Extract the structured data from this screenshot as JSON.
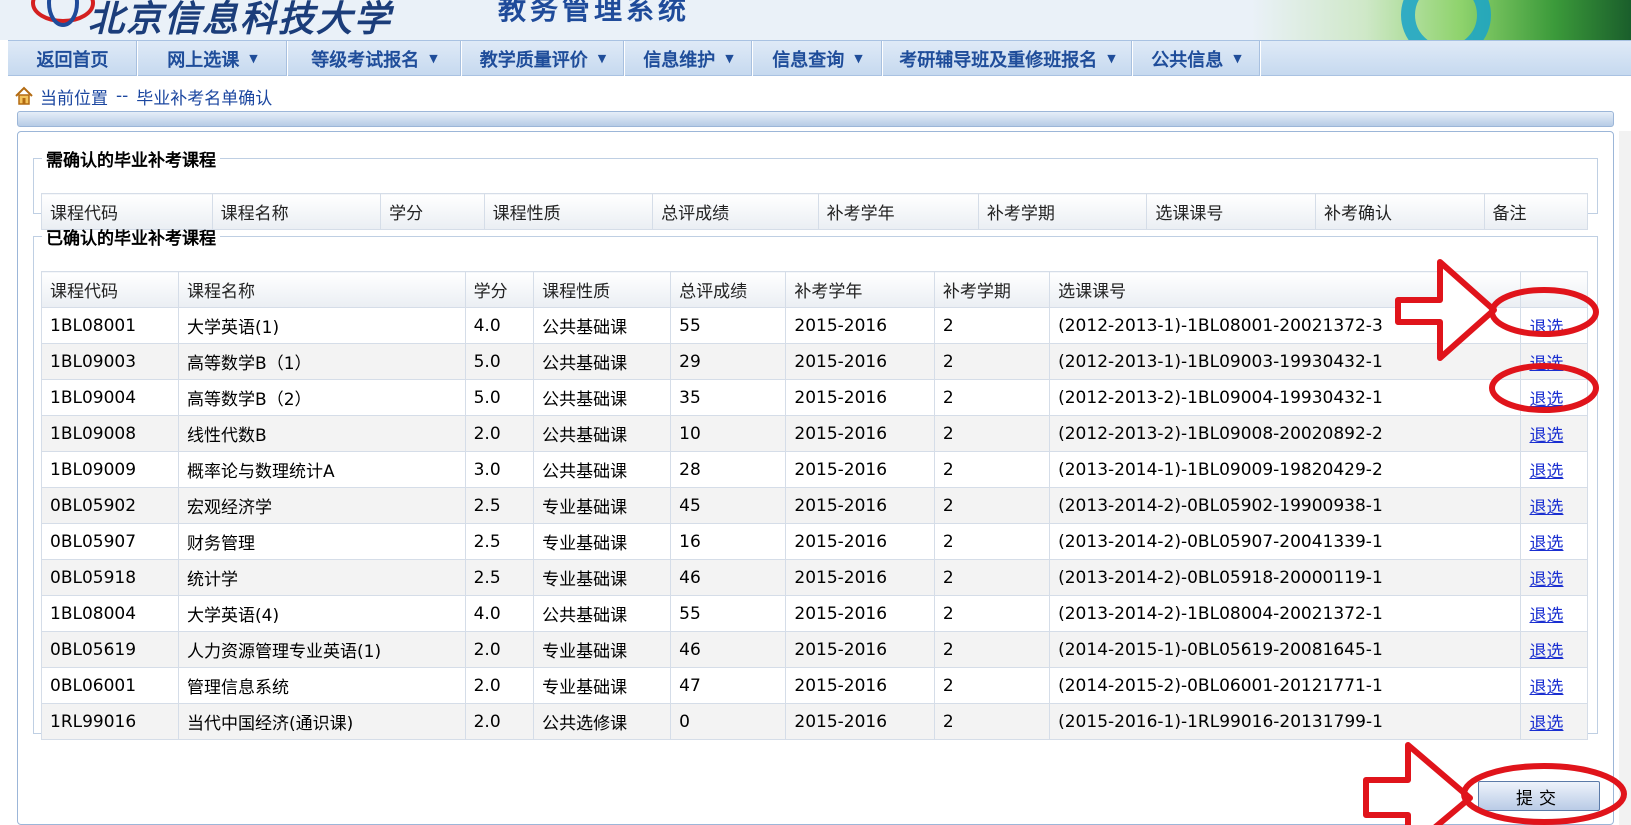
{
  "header": {
    "school_name": "北京信息科技大学",
    "system_name": "教务管理系统"
  },
  "nav": {
    "items": [
      {
        "label": "返回首页",
        "has_caret": false,
        "width": 130
      },
      {
        "label": "网上选课",
        "has_caret": true,
        "width": 150
      },
      {
        "label": "等级考试报名",
        "has_caret": true,
        "width": 174
      },
      {
        "label": "教学质量评价",
        "has_caret": true,
        "width": 163
      },
      {
        "label": "信息维护",
        "has_caret": true,
        "width": 128
      },
      {
        "label": "信息查询",
        "has_caret": true,
        "width": 130
      },
      {
        "label": "考研辅导班及重修班报名",
        "has_caret": true,
        "width": 250
      },
      {
        "label": "公共信息",
        "has_caret": true,
        "width": 128
      }
    ],
    "caret_glyph": "▼"
  },
  "breadcrumb": {
    "current_label": "当前位置",
    "separator": "--",
    "page": "毕业补考名单确认"
  },
  "pending": {
    "legend": "需确认的毕业补考课程",
    "columns": [
      "课程代码",
      "课程名称",
      "学分",
      "课程性质",
      "总评成绩",
      "补考学年",
      "补考学期",
      "选课课号",
      "补考确认",
      "备注"
    ]
  },
  "confirmed": {
    "legend": "已确认的毕业补考课程",
    "columns": [
      "课程代码",
      "课程名称",
      "学分",
      "课程性质",
      "总评成绩",
      "补考学年",
      "补考学期",
      "选课课号",
      ""
    ],
    "action_label": "退选",
    "rows": [
      [
        "1BL08001",
        "大学英语(1)",
        "4.0",
        "公共基础课",
        "55",
        "2015-2016",
        "2",
        "(2012-2013-1)-1BL08001-20021372-3"
      ],
      [
        "1BL09003",
        "高等数学B（1）",
        "5.0",
        "公共基础课",
        "29",
        "2015-2016",
        "2",
        "(2012-2013-1)-1BL09003-19930432-1"
      ],
      [
        "1BL09004",
        "高等数学B（2）",
        "5.0",
        "公共基础课",
        "35",
        "2015-2016",
        "2",
        "(2012-2013-2)-1BL09004-19930432-1"
      ],
      [
        "1BL09008",
        "线性代数B",
        "2.0",
        "公共基础课",
        "10",
        "2015-2016",
        "2",
        "(2012-2013-2)-1BL09008-20020892-2"
      ],
      [
        "1BL09009",
        "概率论与数理统计A",
        "3.0",
        "公共基础课",
        "28",
        "2015-2016",
        "2",
        "(2013-2014-1)-1BL09009-19820429-2"
      ],
      [
        "0BL05902",
        "宏观经济学",
        "2.5",
        "专业基础课",
        "45",
        "2015-2016",
        "2",
        "(2013-2014-2)-0BL05902-19900938-1"
      ],
      [
        "0BL05907",
        "财务管理",
        "2.5",
        "专业基础课",
        "16",
        "2015-2016",
        "2",
        "(2013-2014-2)-0BL05907-20041339-1"
      ],
      [
        "0BL05918",
        "统计学",
        "2.5",
        "专业基础课",
        "46",
        "2015-2016",
        "2",
        "(2013-2014-2)-0BL05918-20000119-1"
      ],
      [
        "1BL08004",
        "大学英语(4)",
        "4.0",
        "公共基础课",
        "55",
        "2015-2016",
        "2",
        "(2013-2014-2)-1BL08004-20021372-1"
      ],
      [
        "0BL05619",
        "人力资源管理专业英语(1)",
        "2.0",
        "专业基础课",
        "46",
        "2015-2016",
        "2",
        "(2014-2015-1)-0BL05619-20081645-1"
      ],
      [
        "0BL06001",
        "管理信息系统",
        "2.0",
        "专业基础课",
        "47",
        "2015-2016",
        "2",
        "(2014-2015-2)-0BL06001-20121771-1"
      ],
      [
        "1RL99016",
        "当代中国经济(通识课)",
        "2.0",
        "公共选修课",
        "0",
        "2015-2016",
        "2",
        "(2015-2016-1)-1RL99016-20131799-1"
      ]
    ]
  },
  "submit_label": "提交",
  "colors": {
    "nav_text": "#1f4d9a",
    "link": "#1a2fd1",
    "annotation_red": "#e0141b"
  }
}
